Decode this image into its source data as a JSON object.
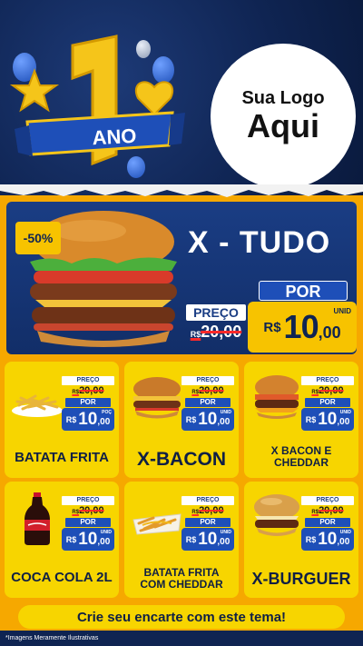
{
  "header": {
    "anniversary_number": "1",
    "anniversary_word": "ANO",
    "logo_line1": "Sua Logo",
    "logo_line2": "Aqui",
    "colors": {
      "navy": "#0f2452",
      "gold": "#f7c300",
      "blue": "#1e4fb8"
    }
  },
  "hero": {
    "discount": "-50%",
    "name": "X - TUDO",
    "preco_label": "PREÇO",
    "old_price_cur": "R$",
    "old_price": "20,00",
    "por_label": "POR",
    "unit_label": "UNID",
    "currency": "R$",
    "price_int": "10",
    "price_dec": ",00",
    "icon": "burger-icon"
  },
  "products": [
    {
      "name": "BATATA FRITA",
      "preco_label": "PREÇO",
      "old_cur": "R$",
      "old_price": "20,00",
      "por_label": "POR",
      "unit": "POÇ",
      "currency": "R$",
      "price_int": "10",
      "price_dec": ",00",
      "icon": "fries-icon"
    },
    {
      "name": "X-BACON",
      "preco_label": "PREÇO",
      "old_cur": "R$",
      "old_price": "20,00",
      "por_label": "POR",
      "unit": "UNID",
      "currency": "R$",
      "price_int": "10",
      "price_dec": ",00",
      "icon": "burger-icon"
    },
    {
      "name": "X BACON E CHEDDAR",
      "preco_label": "PREÇO",
      "old_cur": "R$",
      "old_price": "20,00",
      "por_label": "POR",
      "unit": "UNID",
      "currency": "R$",
      "price_int": "10",
      "price_dec": ",00",
      "icon": "burger-icon"
    },
    {
      "name": "COCA COLA 2L",
      "preco_label": "PREÇO",
      "old_cur": "R$",
      "old_price": "20,00",
      "por_label": "POR",
      "unit": "UNID",
      "currency": "R$",
      "price_int": "10",
      "price_dec": ",00",
      "icon": "soda-bottle-icon"
    },
    {
      "name": "BATATA FRITA COM CHEDDAR",
      "preco_label": "PREÇO",
      "old_cur": "R$",
      "old_price": "20,00",
      "por_label": "POR",
      "unit": "UNID",
      "currency": "R$",
      "price_int": "10",
      "price_dec": ",00",
      "icon": "fries-cheddar-icon"
    },
    {
      "name": "X-BURGUER",
      "preco_label": "PREÇO",
      "old_cur": "R$",
      "old_price": "20,00",
      "por_label": "POR",
      "unit": "UNID",
      "currency": "R$",
      "price_int": "10",
      "price_dec": ",00",
      "icon": "burger-icon"
    }
  ],
  "footer": {
    "cta": "Crie seu encarte com este tema!",
    "disclaimer": "*Imagens Meramente Ilustrativas"
  }
}
